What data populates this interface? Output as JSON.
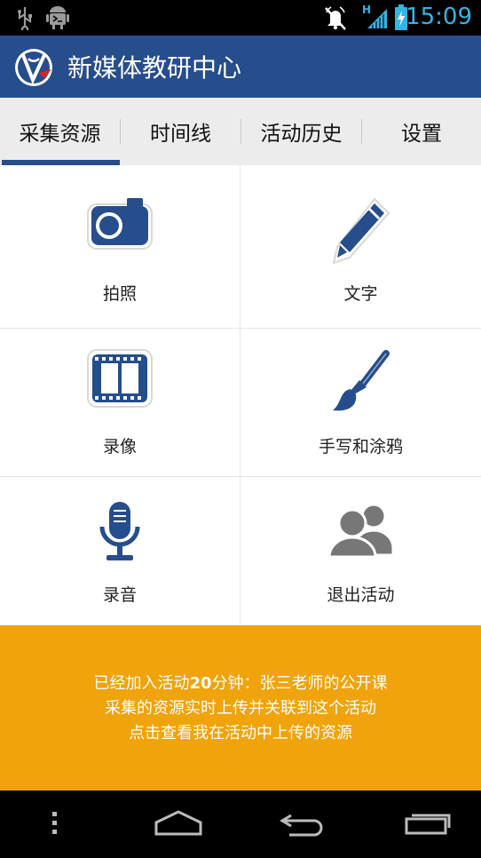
{
  "status_bar": {
    "time": "15:09",
    "network_letter": "H",
    "icons": [
      "usb-icon",
      "android-debug-icon",
      "mute-ring-icon",
      "signal-icon",
      "battery-icon"
    ]
  },
  "app_bar": {
    "title": "新媒体教研中心"
  },
  "tabs": [
    {
      "label": "采集资源",
      "selected": true
    },
    {
      "label": "时间线",
      "selected": false
    },
    {
      "label": "活动历史",
      "selected": false
    },
    {
      "label": "设置",
      "selected": false
    }
  ],
  "grid": [
    {
      "label": "拍照",
      "icon": "camera-icon"
    },
    {
      "label": "文字",
      "icon": "pencil-icon"
    },
    {
      "label": "录像",
      "icon": "film-icon"
    },
    {
      "label": "手写和涂鸦",
      "icon": "brush-icon"
    },
    {
      "label": "录音",
      "icon": "microphone-icon"
    },
    {
      "label": "退出活动",
      "icon": "people-icon"
    }
  ],
  "banner": {
    "line1_prefix": "已经加入活动",
    "line1_minutes": "20",
    "line1_suffix": "分钟：张三老师的公开课",
    "line2": "采集的资源实时上传并关联到这个活动",
    "line3": "点击查看我在活动中上传的资源"
  },
  "colors": {
    "primary": "#264d8c",
    "banner": "#f0a30a",
    "status_blue": "#33b5e5"
  }
}
